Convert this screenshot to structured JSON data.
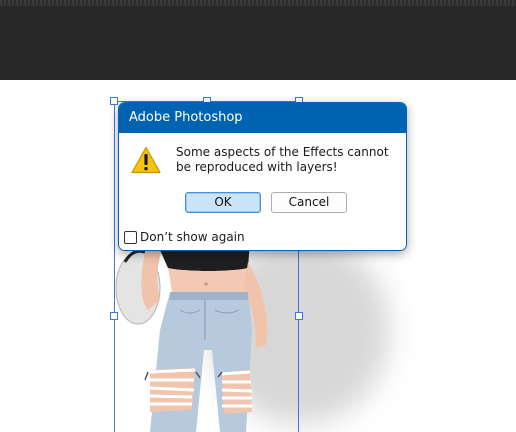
{
  "dialog": {
    "title": "Adobe Photoshop",
    "message": "Some aspects of the Effects cannot be reproduced with layers!",
    "ok_label": "OK",
    "cancel_label": "Cancel",
    "dont_show_label": "Don’t show again",
    "dont_show_checked": false,
    "icon": "warning-icon"
  },
  "colors": {
    "titlebar": "#0063b1",
    "workspace": "#282828",
    "selection": "#3b7ad8",
    "ok_button": "#cce4f7"
  }
}
